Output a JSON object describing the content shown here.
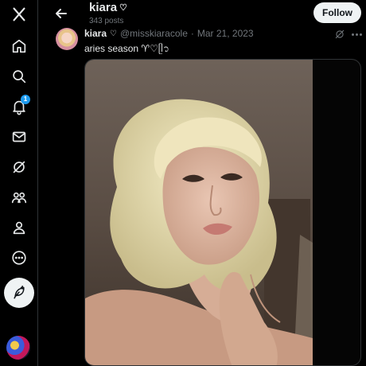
{
  "nav": {
    "items": [
      {
        "icon": "x-logo-icon"
      },
      {
        "icon": "home-icon"
      },
      {
        "icon": "search-icon"
      },
      {
        "icon": "notifications-icon",
        "badge": "1"
      },
      {
        "icon": "messages-icon"
      },
      {
        "icon": "grok-icon"
      },
      {
        "icon": "communities-icon"
      },
      {
        "icon": "profile-icon"
      },
      {
        "icon": "more-circle-icon"
      }
    ],
    "post_button_icon": "feather-icon"
  },
  "header": {
    "name": "kiara",
    "name_suffix": "♡",
    "post_count": "343 posts",
    "follow_label": "Follow"
  },
  "tweet": {
    "author_name": "kiara",
    "author_suffix": "♡",
    "handle": "@misskiaracole",
    "separator": "·",
    "date": "Mar 21, 2023",
    "text": "aries season ♈︎♡ᥫ᭡"
  },
  "colors": {
    "background": "#000000",
    "text_primary": "#e7e9ea",
    "text_secondary": "#71767b",
    "accent": "#1d9bf0",
    "button_light": "#eff3f4",
    "border": "#2f3336"
  }
}
